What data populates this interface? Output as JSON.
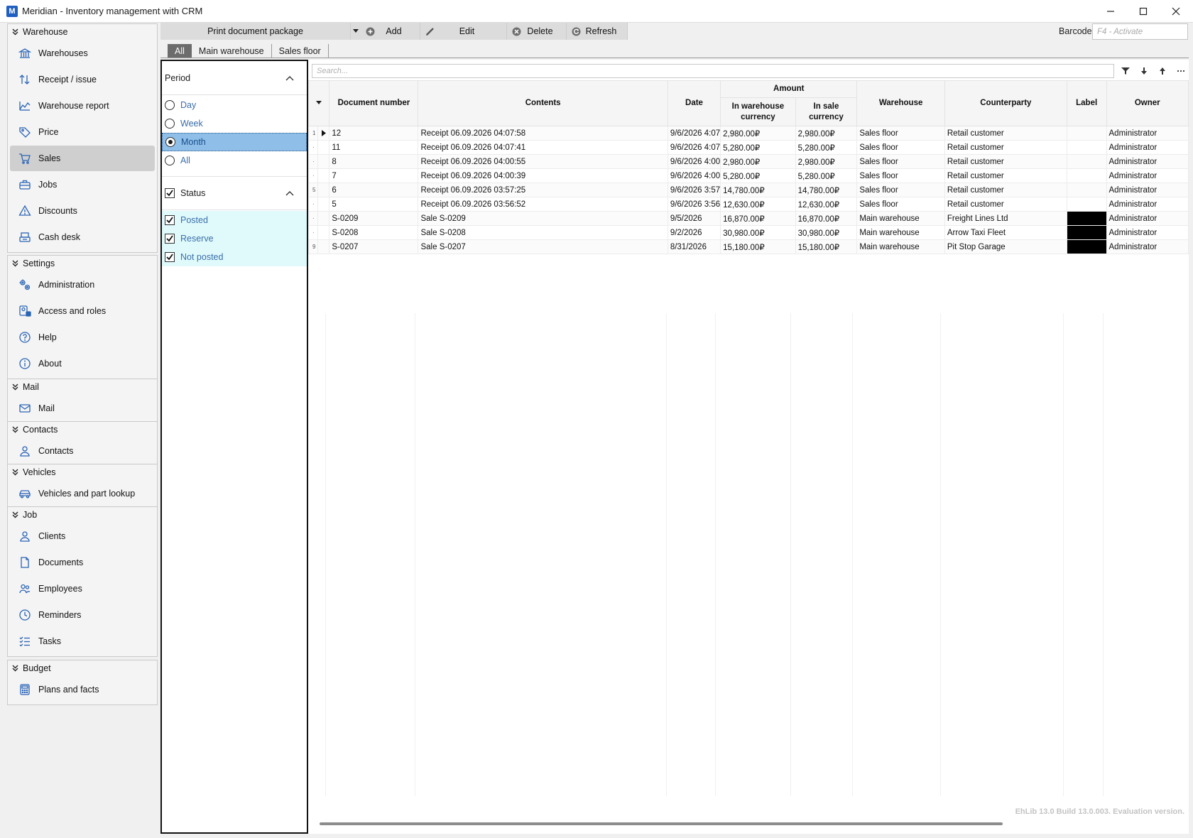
{
  "window": {
    "logo_letter": "M",
    "title": "Meridian - Inventory management with CRM"
  },
  "sidebar": {
    "groups": [
      {
        "title": "Warehouse",
        "items": [
          {
            "label": "Warehouses",
            "icon": "bank-icon"
          },
          {
            "label": "Receipt / issue",
            "icon": "updown-arrows-icon"
          },
          {
            "label": "Warehouse report",
            "icon": "chart-icon"
          },
          {
            "label": "Price",
            "icon": "tag-icon"
          },
          {
            "label": "Sales",
            "icon": "cart-icon",
            "active": true
          },
          {
            "label": "Jobs",
            "icon": "briefcase-icon"
          },
          {
            "label": "Discounts",
            "icon": "warning-icon"
          },
          {
            "label": "Cash desk",
            "icon": "cash-register-icon"
          }
        ]
      },
      {
        "title": "Settings",
        "items": [
          {
            "label": "Administration",
            "icon": "gears-icon"
          },
          {
            "label": "Access and roles",
            "icon": "user-lock-icon"
          },
          {
            "label": "Help",
            "icon": "help-icon"
          },
          {
            "label": "About",
            "icon": "info-icon"
          }
        ]
      },
      {
        "title": "Mail",
        "items": [
          {
            "label": "Mail",
            "icon": "mail-icon"
          }
        ]
      },
      {
        "title": "Contacts",
        "items": [
          {
            "label": "Contacts",
            "icon": "person-icon"
          }
        ]
      },
      {
        "title": "Vehicles",
        "items": [
          {
            "label": "Vehicles and part lookup",
            "icon": "car-icon"
          }
        ]
      },
      {
        "title": "Job",
        "items": [
          {
            "label": "Clients",
            "icon": "person-icon"
          },
          {
            "label": "Documents",
            "icon": "document-icon"
          },
          {
            "label": "Employees",
            "icon": "people-icon"
          },
          {
            "label": "Reminders",
            "icon": "clock-icon"
          },
          {
            "label": "Tasks",
            "icon": "checklist-icon"
          }
        ]
      },
      {
        "title": "Budget",
        "items": [
          {
            "label": "Plans and facts",
            "icon": "calculator-icon"
          }
        ]
      }
    ]
  },
  "toolbar": {
    "print_label": "Print document package",
    "add_label": "Add",
    "edit_label": "Edit",
    "delete_label": "Delete",
    "refresh_label": "Refresh",
    "barcode_label": "Barcode",
    "barcode_placeholder": "F4 - Activate"
  },
  "warehouse_tabs": [
    {
      "label": "All",
      "active": true
    },
    {
      "label": "Main warehouse"
    },
    {
      "label": "Sales floor"
    }
  ],
  "filter": {
    "period_title": "Period",
    "period_options": [
      {
        "label": "Day",
        "selected": false
      },
      {
        "label": "Week",
        "selected": false
      },
      {
        "label": "Month",
        "selected": true
      },
      {
        "label": "All",
        "selected": false
      }
    ],
    "status_title": "Status",
    "status_checked": true,
    "status_options": [
      {
        "label": "Posted",
        "checked": true
      },
      {
        "label": "Reserve",
        "checked": true
      },
      {
        "label": "Not posted",
        "checked": true
      }
    ]
  },
  "grid": {
    "search_placeholder": "Search...",
    "headers": {
      "doc_number": "Document number",
      "contents": "Contents",
      "date": "Date",
      "amount": "Amount",
      "in_warehouse_currency": "In warehouse currency",
      "in_sale_currency": "In sale currency",
      "warehouse": "Warehouse",
      "counterparty": "Counterparty",
      "label": "Label",
      "owner": "Owner"
    },
    "rows": [
      {
        "rownum": "1",
        "current": true,
        "doc": "12",
        "contents": "Receipt 06.09.2026 04:07:58",
        "date": "9/6/2026 4:07",
        "amt_wh": "2,980.00₽",
        "amt_sale": "2,980.00₽",
        "warehouse": "Sales floor",
        "counterparty": "Retail customer",
        "label_color": "",
        "owner": "Administrator"
      },
      {
        "rownum": "·",
        "doc": "11",
        "contents": "Receipt 06.09.2026 04:07:41",
        "date": "9/6/2026 4:07",
        "amt_wh": "5,280.00₽",
        "amt_sale": "5,280.00₽",
        "warehouse": "Sales floor",
        "counterparty": "Retail customer",
        "label_color": "",
        "owner": "Administrator"
      },
      {
        "rownum": "·",
        "doc": "8",
        "contents": "Receipt 06.09.2026 04:00:55",
        "date": "9/6/2026 4:00",
        "amt_wh": "2,980.00₽",
        "amt_sale": "2,980.00₽",
        "warehouse": "Sales floor",
        "counterparty": "Retail customer",
        "label_color": "",
        "owner": "Administrator"
      },
      {
        "rownum": "·",
        "doc": "7",
        "contents": "Receipt 06.09.2026 04:00:39",
        "date": "9/6/2026 4:00",
        "amt_wh": "5,280.00₽",
        "amt_sale": "5,280.00₽",
        "warehouse": "Sales floor",
        "counterparty": "Retail customer",
        "label_color": "",
        "owner": "Administrator"
      },
      {
        "rownum": "5",
        "doc": "6",
        "contents": "Receipt 06.09.2026 03:57:25",
        "date": "9/6/2026 3:57",
        "amt_wh": "14,780.00₽",
        "amt_sale": "14,780.00₽",
        "warehouse": "Sales floor",
        "counterparty": "Retail customer",
        "label_color": "",
        "owner": "Administrator"
      },
      {
        "rownum": "·",
        "doc": "5",
        "contents": "Receipt 06.09.2026 03:56:52",
        "date": "9/6/2026 3:56",
        "amt_wh": "12,630.00₽",
        "amt_sale": "12,630.00₽",
        "warehouse": "Sales floor",
        "counterparty": "Retail customer",
        "label_color": "",
        "owner": "Administrator"
      },
      {
        "rownum": "·",
        "doc": "S-0209",
        "contents": "Sale S-0209",
        "date": "9/5/2026",
        "amt_wh": "16,870.00₽",
        "amt_sale": "16,870.00₽",
        "warehouse": "Main warehouse",
        "counterparty": "Freight Lines Ltd",
        "label_color": "#000000",
        "owner": "Administrator"
      },
      {
        "rownum": "·",
        "doc": "S-0208",
        "contents": "Sale S-0208",
        "date": "9/2/2026",
        "amt_wh": "30,980.00₽",
        "amt_sale": "30,980.00₽",
        "warehouse": "Main warehouse",
        "counterparty": "Arrow Taxi Fleet",
        "label_color": "#000000",
        "owner": "Administrator"
      },
      {
        "rownum": "9",
        "doc": "S-0207",
        "contents": "Sale S-0207",
        "date": "8/31/2026",
        "amt_wh": "15,180.00₽",
        "amt_sale": "15,180.00₽",
        "warehouse": "Main warehouse",
        "counterparty": "Pit Stop Garage",
        "label_color": "#000000",
        "owner": "Administrator"
      }
    ]
  },
  "footer": {
    "watermark": "EhLib 13.0 Build 13.0.003. Evaluation version."
  },
  "colors": {
    "accent_icon": "#2a64b5",
    "selected_option": "#8fbfe9",
    "status_background": "#e0fafc",
    "active_nav": "#cfcfcf"
  }
}
